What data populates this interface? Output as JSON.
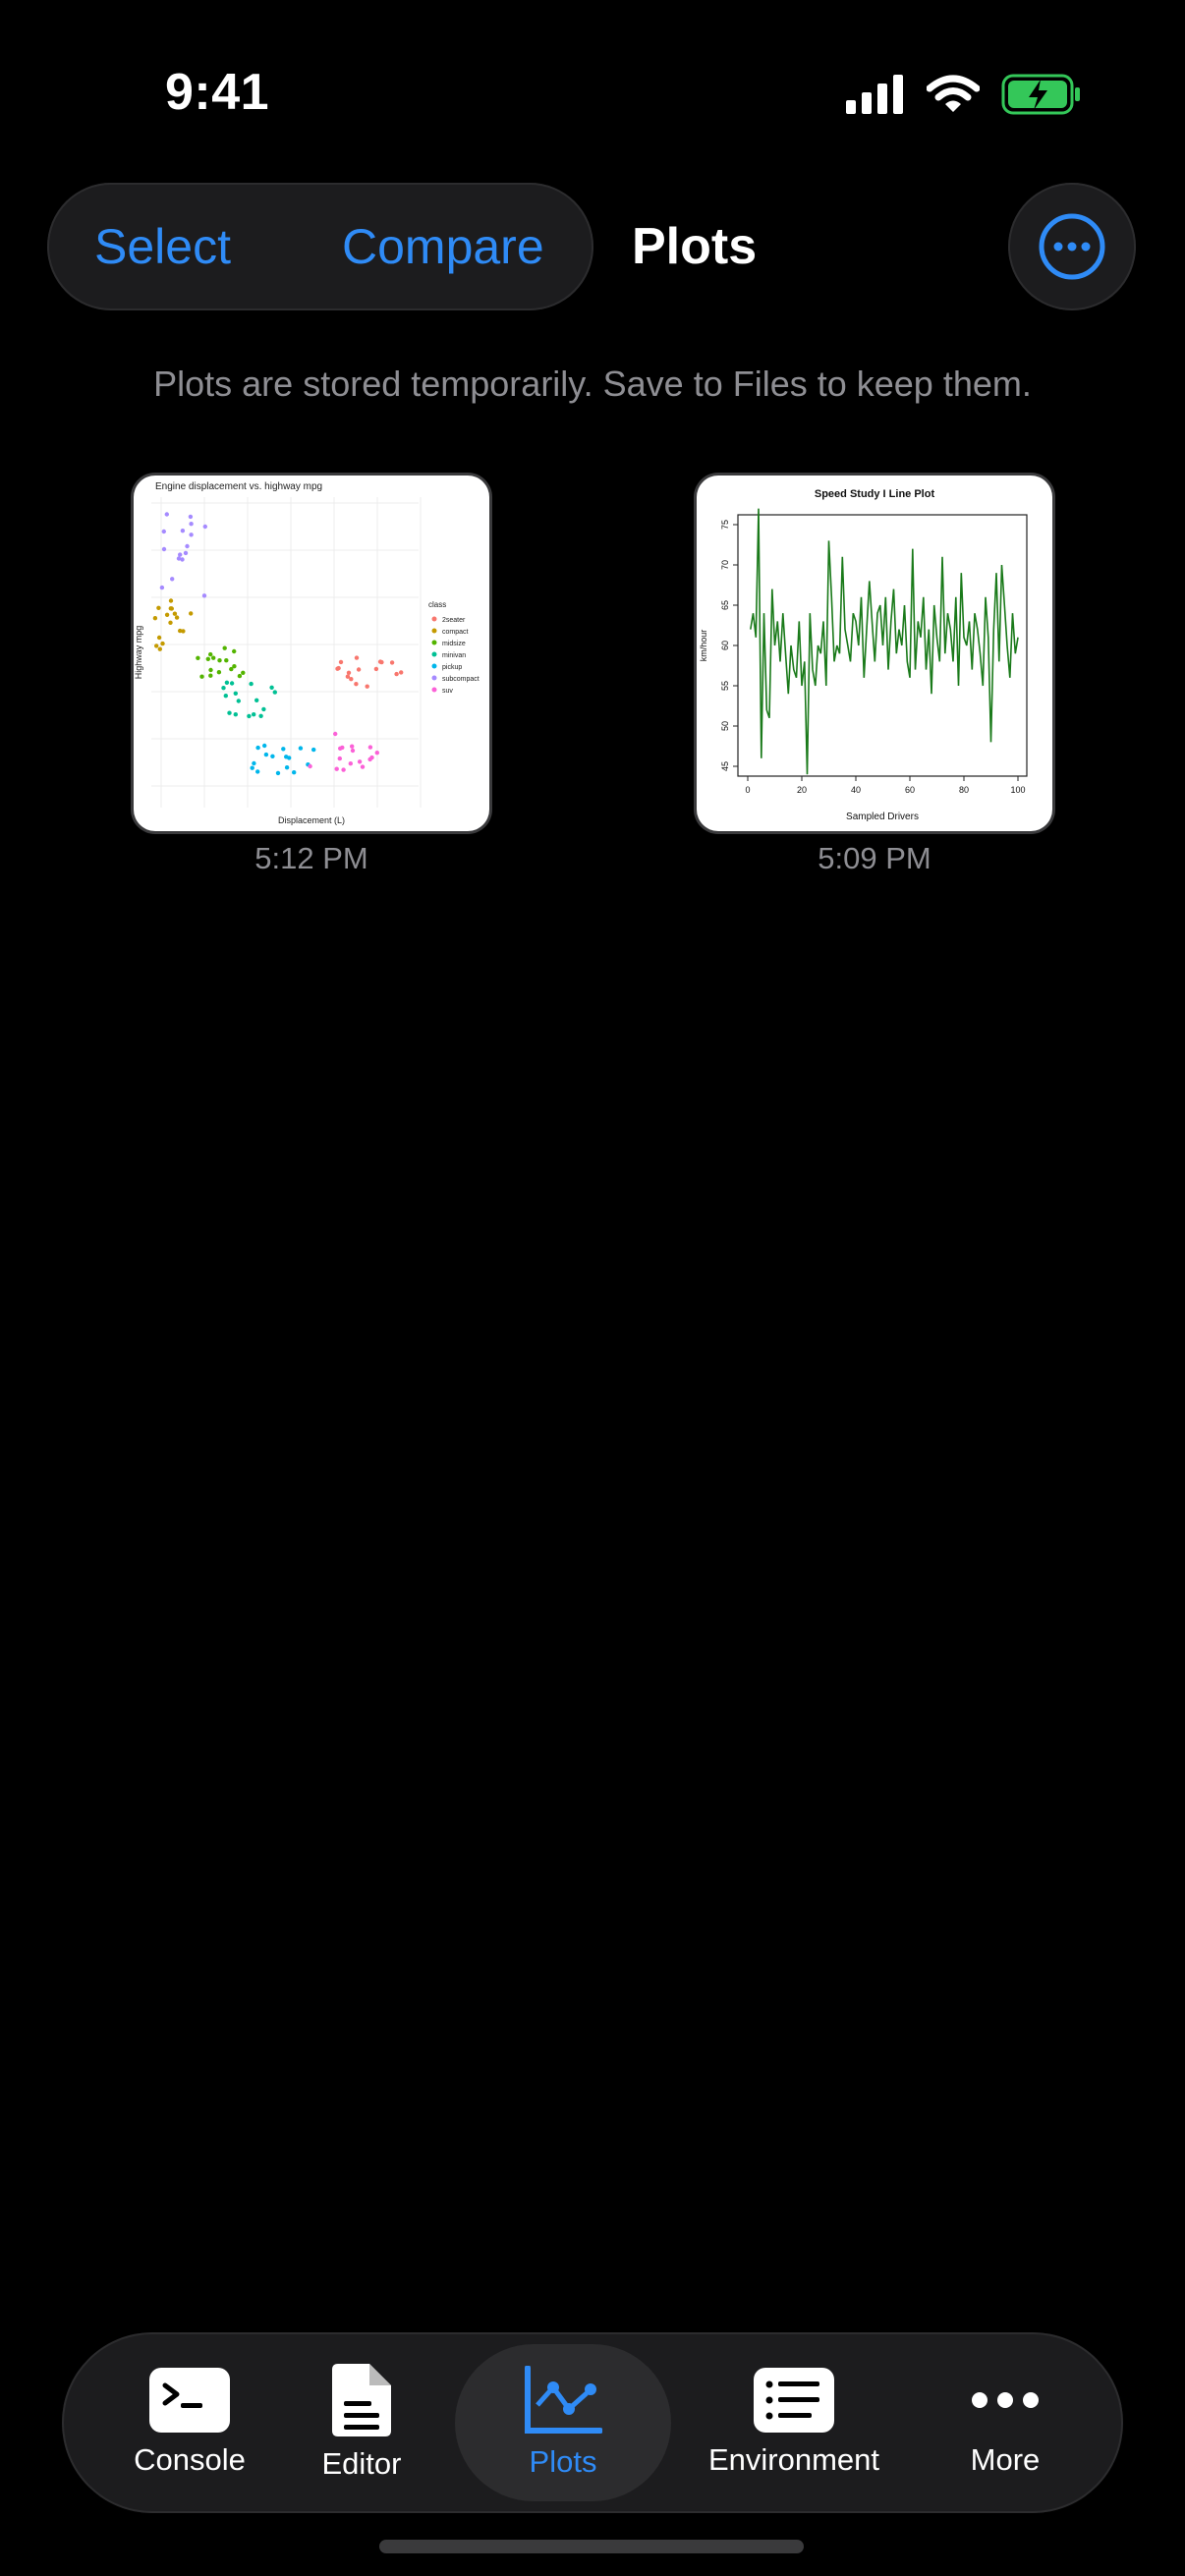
{
  "status": {
    "time": "9:41"
  },
  "toolbar": {
    "select_label": "Select",
    "compare_label": "Compare",
    "title": "Plots"
  },
  "notice": "Plots are stored temporarily. Save to Files to keep them.",
  "plots": [
    {
      "time": "5:12 PM",
      "chart_data": {
        "type": "scatter",
        "title": "Engine displacement vs. highway mpg",
        "xlabel": "Displacement (L)",
        "ylabel": "Highway mpg",
        "legend_title": "class",
        "legend_placement": "right",
        "legend": [
          "2seater",
          "compact",
          "midsize",
          "minivan",
          "pickup",
          "subcompact",
          "suv"
        ]
      }
    },
    {
      "time": "5:09 PM",
      "chart_data": {
        "type": "line",
        "title": "Speed Study I Line Plot",
        "xlabel": "Sampled Drivers",
        "ylabel": "km/hour",
        "xlim": [
          0,
          100
        ],
        "ylim": [
          45,
          75
        ],
        "xticks": [
          "0",
          "20",
          "40",
          "60",
          "80",
          "100"
        ],
        "yticks": [
          "45",
          "50",
          "55",
          "60",
          "65",
          "70",
          "75"
        ],
        "series": [
          {
            "color": "#1a7a1a",
            "x": [
              1,
              2,
              3,
              4,
              5,
              6,
              7,
              8,
              9,
              10,
              11,
              12,
              13,
              14,
              15,
              16,
              17,
              18,
              19,
              20,
              21,
              22,
              23,
              24,
              25,
              26,
              27,
              28,
              29,
              30,
              31,
              32,
              33,
              34,
              35,
              36,
              37,
              38,
              39,
              40,
              41,
              42,
              43,
              44,
              45,
              46,
              47,
              48,
              49,
              50,
              51,
              52,
              53,
              54,
              55,
              56,
              57,
              58,
              59,
              60,
              61,
              62,
              63,
              64,
              65,
              66,
              67,
              68,
              69,
              70,
              71,
              72,
              73,
              74,
              75,
              76,
              77,
              78,
              79,
              80,
              81,
              82,
              83,
              84,
              85,
              86,
              87,
              88,
              89,
              90,
              91,
              92,
              93,
              94,
              95,
              96,
              97,
              98,
              99,
              100
            ],
            "values": [
              62,
              64,
              61,
              77,
              46,
              64,
              52,
              51,
              67,
              60,
              63,
              58,
              64,
              59,
              54,
              60,
              57,
              56,
              63,
              55,
              58,
              44,
              64,
              57,
              55,
              60,
              59,
              63,
              55,
              73,
              66,
              58,
              60,
              59,
              71,
              62,
              60,
              58,
              64,
              63,
              60,
              66,
              56,
              62,
              68,
              63,
              58,
              64,
              65,
              60,
              66,
              57,
              63,
              67,
              59,
              62,
              60,
              65,
              58,
              56,
              72,
              57,
              63,
              61,
              66,
              57,
              62,
              54,
              65,
              61,
              58,
              71,
              59,
              64,
              62,
              58,
              66,
              55,
              69,
              61,
              60,
              63,
              57,
              64,
              62,
              59,
              55,
              66,
              61,
              48,
              62,
              69,
              58,
              70,
              65,
              60,
              56,
              64,
              59,
              61
            ]
          }
        ]
      }
    }
  ],
  "tabs": [
    {
      "label": "Console",
      "icon": "terminal-icon"
    },
    {
      "label": "Editor",
      "icon": "document-icon"
    },
    {
      "label": "Plots",
      "icon": "chart-line-icon",
      "active": true
    },
    {
      "label": "Environment",
      "icon": "list-icon"
    },
    {
      "label": "More",
      "icon": "ellipsis-icon"
    }
  ],
  "colors": {
    "accent": "#2f8bf6",
    "battery": "#34c759"
  }
}
